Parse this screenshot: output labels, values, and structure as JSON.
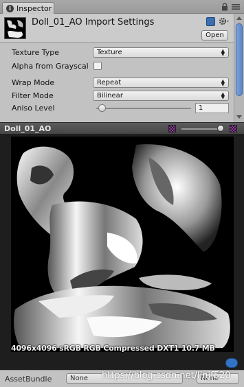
{
  "tab": {
    "label": "Inspector"
  },
  "header": {
    "title": "Doll_01_AO Import Settings",
    "open_label": "Open"
  },
  "settings": {
    "texture_type": {
      "label": "Texture Type",
      "value": "Texture"
    },
    "alpha_from_grayscale": {
      "label": "Alpha from Grayscal",
      "checked": false
    },
    "wrap_mode": {
      "label": "Wrap Mode",
      "value": "Repeat"
    },
    "filter_mode": {
      "label": "Filter Mode",
      "value": "Bilinear"
    },
    "aniso_level": {
      "label": "Aniso Level",
      "value": "1"
    }
  },
  "preview": {
    "title": "Doll_01_AO",
    "info": "4096x4096 sRGB  RGB Compressed DXT1   10.7 MB"
  },
  "asset_bundle": {
    "label": "AssetBundle",
    "value": "None",
    "variant": "None"
  },
  "watermark": "https://blog.csdn.net/linjf520",
  "colors": {
    "accent": "#5a86c9",
    "preview_bg": "#000000",
    "tab_bar": "#9a9a9a"
  }
}
